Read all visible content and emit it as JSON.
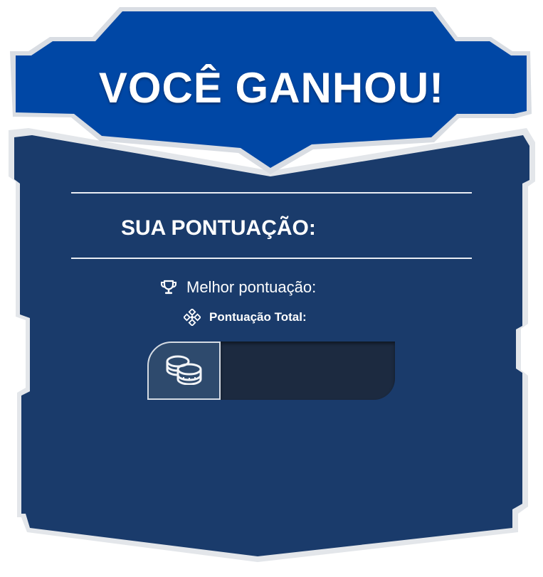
{
  "dialog": {
    "title": "VOCÊ GANHOU!",
    "score_label": "SUA PONTUAÇÃO:",
    "score_value": "",
    "best_score_label": "Melhor pontuação:",
    "best_score_value": "",
    "total_score_label": "Pontuação Total:",
    "total_score_value": "",
    "coins_value": ""
  },
  "icons": {
    "best_score": "trophy-icon",
    "total_score": "diamond-grid-icon",
    "coins": "coins-icon"
  },
  "colors": {
    "header_blue": "#0047a5",
    "panel_navy": "#1a3b6b",
    "coin_cell": "#2e4a6d",
    "coin_value_bg": "#1c2a40",
    "text": "#ffffff"
  }
}
